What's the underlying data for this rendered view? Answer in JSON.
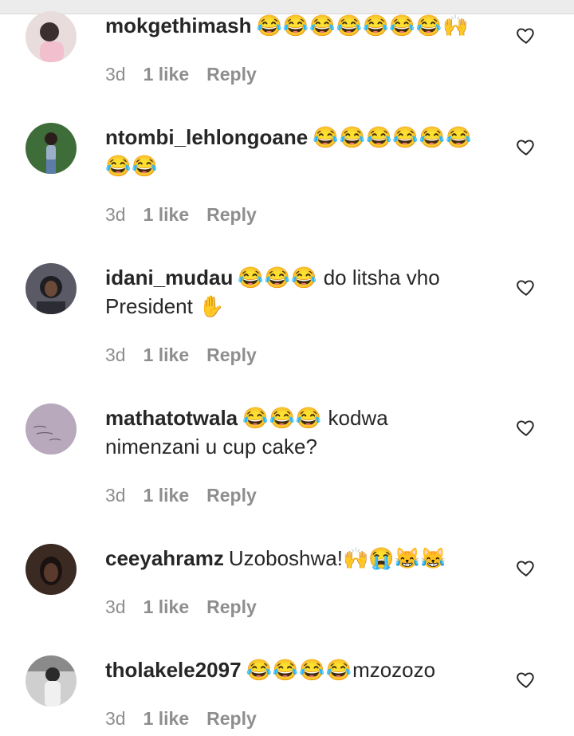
{
  "comments": [
    {
      "username": "mokgethimash",
      "emojis": "😂😂😂😂😂😂😂🙌",
      "text": "",
      "time": "3d",
      "likes": "1 like",
      "reply": "Reply",
      "avatar_bg": "#e8dcdc",
      "avatar_fg": "#3b2f2f"
    },
    {
      "username": "ntombi_lehlongoane",
      "emojis": "😂😂😂😂😂😂😂😂",
      "text": "",
      "time": "3d",
      "likes": "1 like",
      "reply": "Reply",
      "avatar_bg": "#3f6d3a",
      "avatar_fg": "#9bb0c8"
    },
    {
      "username": "idani_mudau",
      "emojis": "😂😂😂",
      "text": "do litsha vho President ✋",
      "time": "3d",
      "likes": "1 like",
      "reply": "Reply",
      "avatar_bg": "#5a5a66",
      "avatar_fg": "#1e1e22"
    },
    {
      "username": "mathatotwala",
      "emojis": "😂😂😂",
      "text": "kodwa nimenzani u cup cake?",
      "time": "3d",
      "likes": "1 like",
      "reply": "Reply",
      "avatar_bg": "#b8a9bc",
      "avatar_fg": "#6f5f74"
    },
    {
      "username": "ceeyahramz",
      "emojis": "",
      "text": "Uzoboshwa!🙌😭😹😹",
      "time": "3d",
      "likes": "1 like",
      "reply": "Reply",
      "avatar_bg": "#3b2a22",
      "avatar_fg": "#1a1210"
    },
    {
      "username": "tholakele2097",
      "emojis": "😂😂😂😂",
      "text": "mzozozo",
      "time": "3d",
      "likes": "1 like",
      "reply": "Reply",
      "avatar_bg": "#cfcfcf",
      "avatar_fg": "#2a2a2a"
    }
  ]
}
